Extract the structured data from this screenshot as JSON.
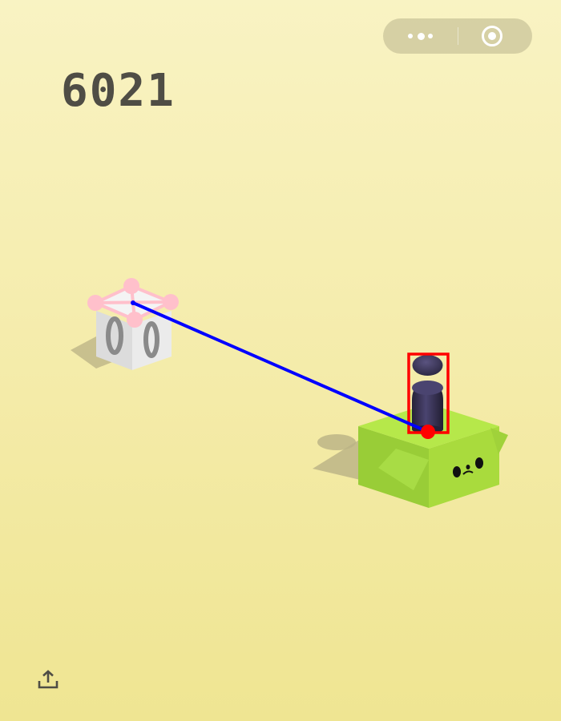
{
  "game": {
    "score": "6021"
  },
  "capsule": {
    "more_icon": "more-dots-icon",
    "close_icon": "target-close-icon"
  },
  "scene": {
    "player_icon": "chess-pawn-piece",
    "current_block": "green-cat-face-box",
    "target_block": "white-cube-with-zeros",
    "target_marker": "pink-diamond-target-marker"
  },
  "footer": {
    "share_icon": "share-upload-icon"
  },
  "colors": {
    "background_top": "#f9f3c3",
    "background_bottom": "#efe592",
    "score": "#4f4d45",
    "green_block": "#a6d93e",
    "player_piece": "#3b3655",
    "aim_line": "#0000ff",
    "highlight_box": "#ff0000",
    "target_marker": "#ffc0cb"
  }
}
